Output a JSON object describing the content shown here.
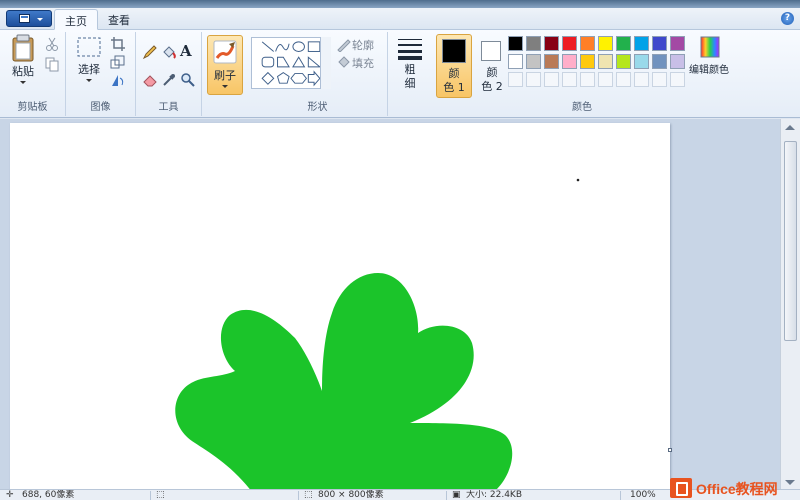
{
  "tabs": {
    "home": "主页",
    "view": "查看"
  },
  "help": "?",
  "clipboard": {
    "paste": "粘贴",
    "group": "剪贴板"
  },
  "image": {
    "select": "选择",
    "group": "图像"
  },
  "tools": {
    "group": "工具",
    "text_tool": "A"
  },
  "brushes": {
    "label": "刷子"
  },
  "shapes": {
    "outline": "轮廓",
    "fill": "填充",
    "group": "形状"
  },
  "size": {
    "line1": "粗",
    "line2": "细"
  },
  "colors": {
    "color1_label": "颜色 1",
    "color1_line1": "颜",
    "color1_line2": "色 1",
    "color2_line1": "颜",
    "color2_line2": "色 2",
    "edit": "编辑颜色",
    "group": "颜色",
    "color1_value": "#000000",
    "color2_value": "#ffffff",
    "palette_row1": [
      "#000000",
      "#7f7f7f",
      "#880015",
      "#ed1c24",
      "#ff7f27",
      "#fff200",
      "#22b14c",
      "#00a2e8",
      "#3f48cc",
      "#a349a4"
    ],
    "palette_row2": [
      "#ffffff",
      "#c3c3c3",
      "#b97a57",
      "#ffaec9",
      "#ffc90e",
      "#efe4b0",
      "#b5e61d",
      "#99d9ea",
      "#7092be",
      "#c8bfe7"
    ]
  },
  "drawing": {
    "fill_color": "#1bc42a"
  },
  "status": {
    "cursor": "688, 60像素",
    "dimensions": "800 × 800像素",
    "filesize": "大小: 22.4KB",
    "zoom": "100%"
  },
  "watermark": {
    "text": "Office教程网"
  }
}
